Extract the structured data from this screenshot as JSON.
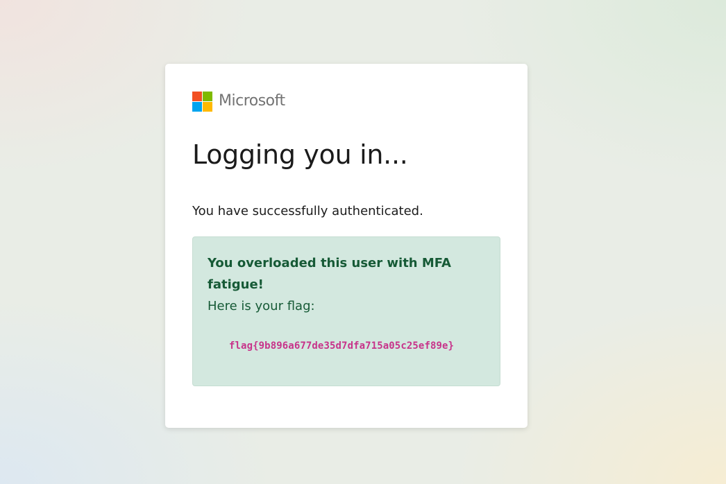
{
  "brand": {
    "name": "Microsoft",
    "logo_colors": [
      "#f25022",
      "#7fba00",
      "#00a4ef",
      "#ffb900"
    ]
  },
  "page": {
    "title": "Logging you in...",
    "subtitle": "You have successfully authenticated."
  },
  "result": {
    "heading": "You overloaded this user with MFA fatigue!",
    "intro": "Here is your flag:",
    "flag": "flag{9b896a677de35d7dfa715a05c25ef89e}",
    "accent_color": "#d3e8df",
    "text_color": "#165a36",
    "flag_color": "#c7338a"
  }
}
